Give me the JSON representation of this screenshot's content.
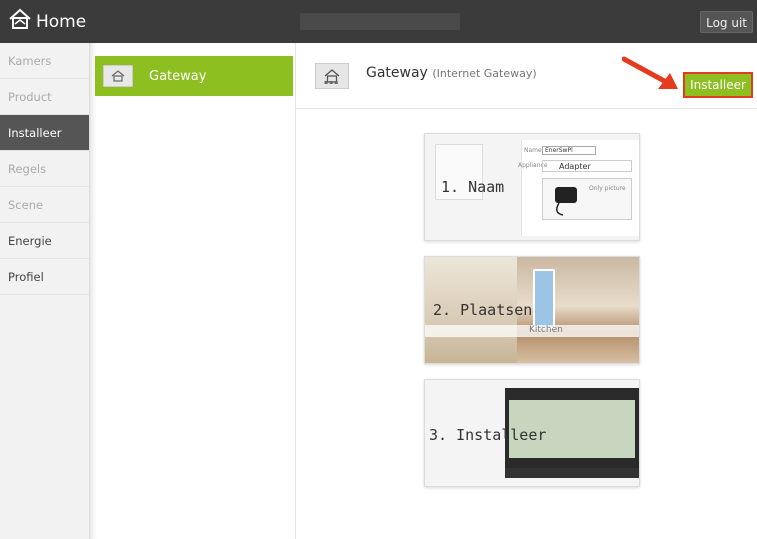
{
  "header": {
    "brand_label": "Home",
    "logout_label": "Log uit"
  },
  "sidebar": {
    "items": [
      {
        "label": "Kamers"
      },
      {
        "label": "Product"
      },
      {
        "label": "Installeer"
      },
      {
        "label": "Regels"
      },
      {
        "label": "Scene"
      },
      {
        "label": "Energie"
      },
      {
        "label": "Profiel"
      }
    ]
  },
  "devices": {
    "items": [
      {
        "label": "Gateway"
      }
    ]
  },
  "main": {
    "title": "Gateway",
    "subtitle": "(Internet Gateway)",
    "install_label": "Installeer",
    "steps": [
      {
        "label": "1. Naam"
      },
      {
        "label": "2. Plaatsen"
      },
      {
        "label": "3. Installeer"
      }
    ],
    "step1_form": {
      "name_label": "Name:",
      "name_value": "EnerSwPl",
      "appliance_label": "Appliance",
      "appliance_value": "Adapter",
      "picture_text": "Only picture"
    },
    "step2_room_label": "Kitchen",
    "accent_color": "#8cbf1f",
    "highlight_color": "#e53a1e"
  }
}
